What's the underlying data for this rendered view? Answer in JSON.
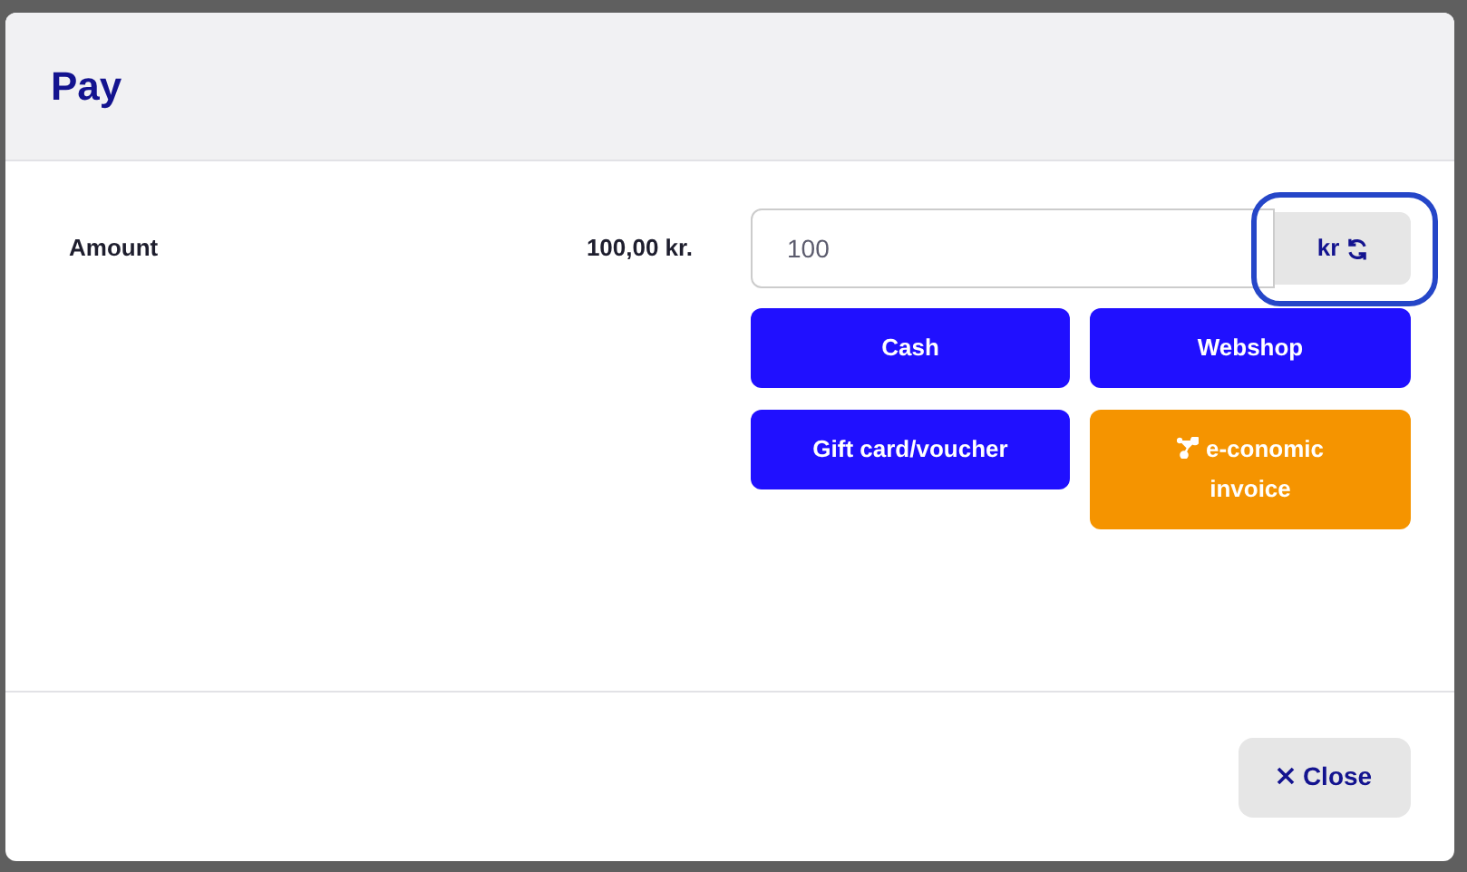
{
  "dialog": {
    "title": "Pay"
  },
  "amount": {
    "label": "Amount",
    "value": "100,00 kr.",
    "input_value": "100",
    "currency": {
      "label": "kr",
      "focused": true
    }
  },
  "payment_buttons": [
    {
      "label": "Cash",
      "kind": "primary"
    },
    {
      "label": "Webshop",
      "kind": "primary"
    },
    {
      "label": "Gift card/voucher",
      "kind": "primary"
    },
    {
      "label": "e-conomic invoice",
      "kind": "integration"
    }
  ],
  "footer": {
    "close_button": "Close"
  }
}
